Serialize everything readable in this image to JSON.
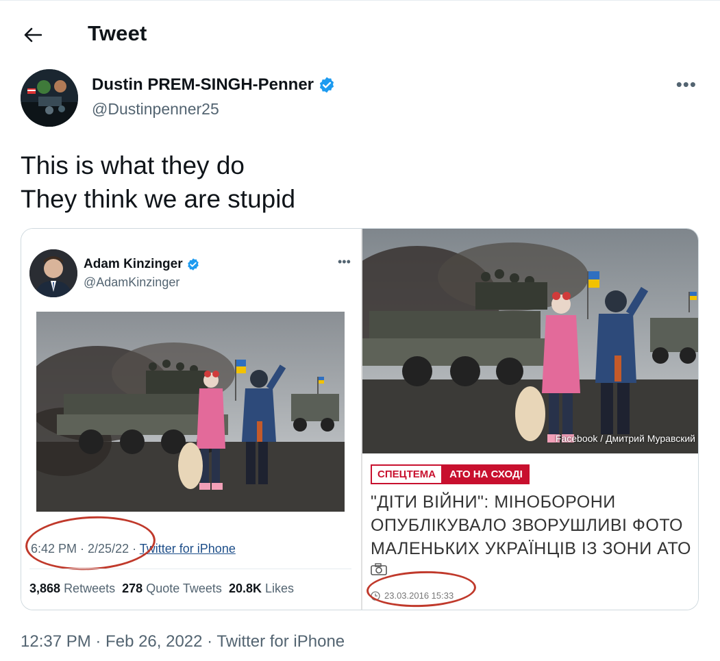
{
  "header": {
    "title": "Tweet"
  },
  "author": {
    "name": "Dustin PREM-SINGH-Penner",
    "handle": "@Dustinpenner25"
  },
  "tweet": {
    "text": "This is what they do\nThey think we are stupid"
  },
  "embedded_tweet": {
    "name": "Adam Kinzinger",
    "handle": "@AdamKinzinger",
    "time": "6:42 PM · 2/25/22 ·",
    "source": "Twitter for iPhone",
    "stats": {
      "retweets_count": "3,868",
      "retweets_label": "Retweets",
      "quotes_count": "278",
      "quotes_label": "Quote Tweets",
      "likes_count": "20.8K",
      "likes_label": "Likes"
    }
  },
  "news_article": {
    "photo_credit": "Facebook / Дмитрий Муравский",
    "tag1": "СПЕЦТЕМА",
    "tag2": "АТО НА СХОДІ",
    "headline": "\"ДІТИ ВІЙНИ\": МІНОБОРОНИ ОПУБЛІКУВАЛО ЗВОРУШЛИВІ ФОТО МАЛЕНЬКИХ УКРАЇНЦІВ ІЗ ЗОНИ АТО",
    "date": "23.03.2016 15:33"
  },
  "footer": {
    "meta": "12:37 PM · Feb 26, 2022 · Twitter for iPhone"
  },
  "colors": {
    "verified": "#1d9bf0",
    "annotation_circle": "#c0392b",
    "news_red": "#c8102e"
  },
  "icons": [
    "back-arrow-icon",
    "verified-badge-icon",
    "more-icon",
    "camera-icon",
    "clock-icon"
  ]
}
